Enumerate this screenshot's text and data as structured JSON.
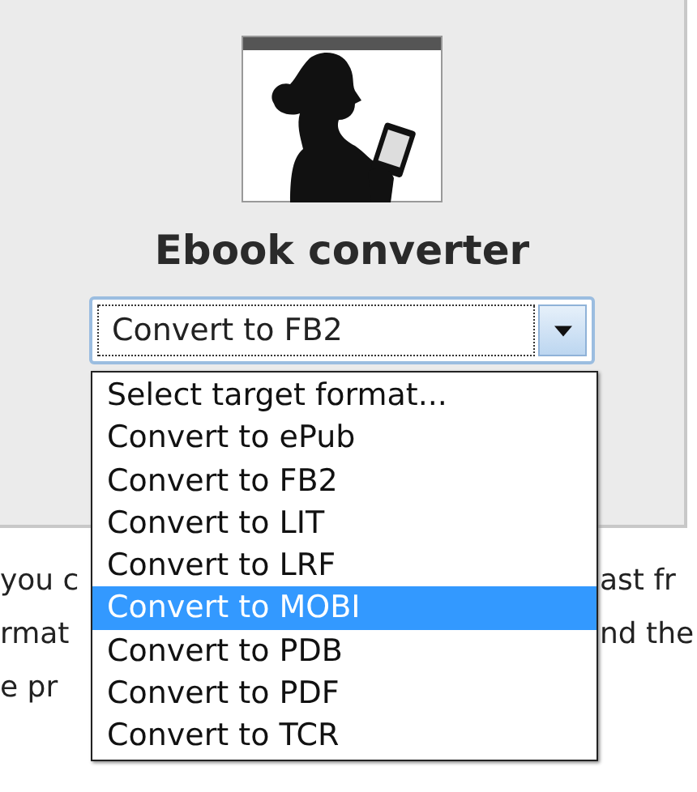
{
  "title": "Ebook converter",
  "select": {
    "value": "Convert to FB2",
    "expanded": true
  },
  "options": [
    {
      "label": "Select target format...",
      "selected": false
    },
    {
      "label": "Convert to ePub",
      "selected": false
    },
    {
      "label": "Convert to FB2",
      "selected": false
    },
    {
      "label": "Convert to LIT",
      "selected": false
    },
    {
      "label": "Convert to LRF",
      "selected": false
    },
    {
      "label": "Convert to MOBI",
      "selected": true
    },
    {
      "label": "Convert to PDB",
      "selected": false
    },
    {
      "label": "Convert to PDF",
      "selected": false
    },
    {
      "label": "Convert to TCR",
      "selected": false
    }
  ],
  "background_text": [
    {
      "left": "you c",
      "right": "ast fr"
    },
    {
      "left": "rmat",
      "right": "nd the"
    },
    {
      "left": "e pr"
    }
  ]
}
